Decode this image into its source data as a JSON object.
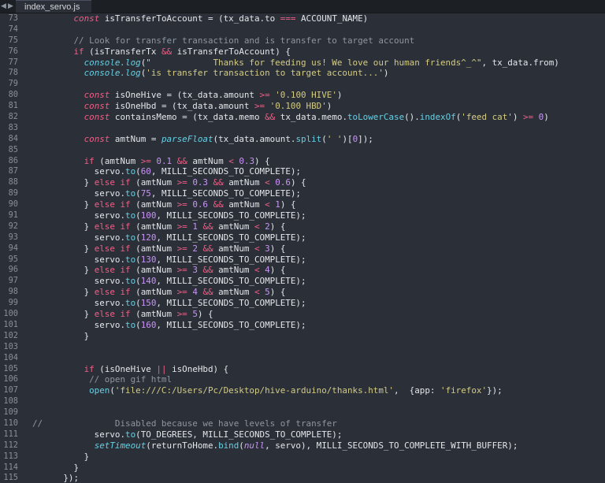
{
  "tab": {
    "filename": "index_servo.js",
    "nav_left": "◀",
    "nav_right": "▶"
  },
  "colors": {
    "background": "#2b3038",
    "keyword": "#ef5e86",
    "plain": "#e3e6ea",
    "string": "#d3cb84",
    "number": "#c994f6",
    "function": "#66cfe4",
    "comment": "#8e959e",
    "line_number": "#8a8f96"
  },
  "lines": [
    {
      "n": "73",
      "tokens": [
        [
          "        ",
          "pl"
        ],
        [
          "const",
          "kw"
        ],
        [
          " isTransferToAccount = (tx_data.to ",
          "pl"
        ],
        [
          "===",
          "op"
        ],
        [
          " ACCOUNT_NAME)",
          "pl"
        ]
      ]
    },
    {
      "n": "74",
      "tokens": []
    },
    {
      "n": "75",
      "tokens": [
        [
          "        ",
          "pl"
        ],
        [
          "// Look for transfer transaction and is transfer to target account",
          "cm"
        ]
      ]
    },
    {
      "n": "76",
      "tokens": [
        [
          "        ",
          "pl"
        ],
        [
          "if",
          "op"
        ],
        [
          " (isTransferTx ",
          "pl"
        ],
        [
          "&&",
          "op"
        ],
        [
          " isTransferToAccount) {",
          "pl"
        ]
      ]
    },
    {
      "n": "77",
      "tokens": [
        [
          "          ",
          "pl"
        ],
        [
          "console.log",
          "fn it"
        ],
        [
          "(",
          "pl"
        ],
        [
          "\"            Thanks for feeding us! We love our human friends^_^\"",
          "str"
        ],
        [
          ", tx_data.from)",
          "pl"
        ]
      ]
    },
    {
      "n": "78",
      "tokens": [
        [
          "          ",
          "pl"
        ],
        [
          "console.log",
          "fn it"
        ],
        [
          "(",
          "pl"
        ],
        [
          "'is transfer transaction to target account...'",
          "str"
        ],
        [
          ")",
          "pl"
        ]
      ]
    },
    {
      "n": "79",
      "tokens": []
    },
    {
      "n": "80",
      "tokens": [
        [
          "          ",
          "pl"
        ],
        [
          "const",
          "kw"
        ],
        [
          " isOneHive = (tx_data.amount ",
          "pl"
        ],
        [
          ">=",
          "op"
        ],
        [
          " ",
          "pl"
        ],
        [
          "'0.100 HIVE'",
          "str"
        ],
        [
          ")",
          "pl"
        ]
      ]
    },
    {
      "n": "81",
      "tokens": [
        [
          "          ",
          "pl"
        ],
        [
          "const",
          "kw"
        ],
        [
          " isOneHbd = (tx_data.amount ",
          "pl"
        ],
        [
          ">=",
          "op"
        ],
        [
          " ",
          "pl"
        ],
        [
          "'0.100 HBD'",
          "str"
        ],
        [
          ")",
          "pl"
        ]
      ]
    },
    {
      "n": "82",
      "tokens": [
        [
          "          ",
          "pl"
        ],
        [
          "const",
          "kw"
        ],
        [
          " containsMemo = (tx_data.memo ",
          "pl"
        ],
        [
          "&&",
          "op"
        ],
        [
          " tx_data.memo.",
          "pl"
        ],
        [
          "toLowerCase",
          "fn"
        ],
        [
          "().",
          "pl"
        ],
        [
          "indexOf",
          "fn"
        ],
        [
          "(",
          "pl"
        ],
        [
          "'feed cat'",
          "str"
        ],
        [
          ") ",
          "pl"
        ],
        [
          ">=",
          "op"
        ],
        [
          " ",
          "pl"
        ],
        [
          "0",
          "num"
        ],
        [
          ")",
          "pl"
        ]
      ]
    },
    {
      "n": "83",
      "tokens": []
    },
    {
      "n": "84",
      "tokens": [
        [
          "          ",
          "pl"
        ],
        [
          "const",
          "kw"
        ],
        [
          " amtNum = ",
          "pl"
        ],
        [
          "parseFloat",
          "fn it"
        ],
        [
          "(tx_data.amount.",
          "pl"
        ],
        [
          "split",
          "fn"
        ],
        [
          "(",
          "pl"
        ],
        [
          "' '",
          "str"
        ],
        [
          ")[",
          "pl"
        ],
        [
          "0",
          "num"
        ],
        [
          "]);",
          "pl"
        ]
      ]
    },
    {
      "n": "85",
      "tokens": []
    },
    {
      "n": "86",
      "tokens": [
        [
          "          ",
          "pl"
        ],
        [
          "if",
          "op"
        ],
        [
          " (amtNum ",
          "pl"
        ],
        [
          ">=",
          "op"
        ],
        [
          " ",
          "pl"
        ],
        [
          "0.1",
          "num"
        ],
        [
          " ",
          "pl"
        ],
        [
          "&&",
          "op"
        ],
        [
          " amtNum ",
          "pl"
        ],
        [
          "<",
          "op"
        ],
        [
          " ",
          "pl"
        ],
        [
          "0.3",
          "num"
        ],
        [
          ") {",
          "pl"
        ]
      ]
    },
    {
      "n": "87",
      "tokens": [
        [
          "            servo.",
          "pl"
        ],
        [
          "to",
          "fn"
        ],
        [
          "(",
          "pl"
        ],
        [
          "60",
          "num"
        ],
        [
          ", MILLI_SECONDS_TO_COMPLETE);",
          "pl"
        ]
      ]
    },
    {
      "n": "88",
      "tokens": [
        [
          "          } ",
          "pl"
        ],
        [
          "else",
          "op"
        ],
        [
          " ",
          "pl"
        ],
        [
          "if",
          "op"
        ],
        [
          " (amtNum ",
          "pl"
        ],
        [
          ">=",
          "op"
        ],
        [
          " ",
          "pl"
        ],
        [
          "0.3",
          "num"
        ],
        [
          " ",
          "pl"
        ],
        [
          "&&",
          "op"
        ],
        [
          " amtNum ",
          "pl"
        ],
        [
          "<",
          "op"
        ],
        [
          " ",
          "pl"
        ],
        [
          "0.6",
          "num"
        ],
        [
          ") {",
          "pl"
        ]
      ]
    },
    {
      "n": "89",
      "tokens": [
        [
          "            servo.",
          "pl"
        ],
        [
          "to",
          "fn"
        ],
        [
          "(",
          "pl"
        ],
        [
          "75",
          "num"
        ],
        [
          ", MILLI_SECONDS_TO_COMPLETE);",
          "pl"
        ]
      ]
    },
    {
      "n": "90",
      "tokens": [
        [
          "          } ",
          "pl"
        ],
        [
          "else",
          "op"
        ],
        [
          " ",
          "pl"
        ],
        [
          "if",
          "op"
        ],
        [
          " (amtNum ",
          "pl"
        ],
        [
          ">=",
          "op"
        ],
        [
          " ",
          "pl"
        ],
        [
          "0.6",
          "num"
        ],
        [
          " ",
          "pl"
        ],
        [
          "&&",
          "op"
        ],
        [
          " amtNum ",
          "pl"
        ],
        [
          "<",
          "op"
        ],
        [
          " ",
          "pl"
        ],
        [
          "1",
          "num"
        ],
        [
          ") {",
          "pl"
        ]
      ]
    },
    {
      "n": "91",
      "tokens": [
        [
          "            servo.",
          "pl"
        ],
        [
          "to",
          "fn"
        ],
        [
          "(",
          "pl"
        ],
        [
          "100",
          "num"
        ],
        [
          ", MILLI_SECONDS_TO_COMPLETE);",
          "pl"
        ]
      ]
    },
    {
      "n": "92",
      "tokens": [
        [
          "          } ",
          "pl"
        ],
        [
          "else",
          "op"
        ],
        [
          " ",
          "pl"
        ],
        [
          "if",
          "op"
        ],
        [
          " (amtNum ",
          "pl"
        ],
        [
          ">=",
          "op"
        ],
        [
          " ",
          "pl"
        ],
        [
          "1",
          "num"
        ],
        [
          " ",
          "pl"
        ],
        [
          "&&",
          "op"
        ],
        [
          " amtNum ",
          "pl"
        ],
        [
          "<",
          "op"
        ],
        [
          " ",
          "pl"
        ],
        [
          "2",
          "num"
        ],
        [
          ") {",
          "pl"
        ]
      ]
    },
    {
      "n": "93",
      "tokens": [
        [
          "            servo.",
          "pl"
        ],
        [
          "to",
          "fn"
        ],
        [
          "(",
          "pl"
        ],
        [
          "120",
          "num"
        ],
        [
          ", MILLI_SECONDS_TO_COMPLETE);",
          "pl"
        ]
      ]
    },
    {
      "n": "94",
      "tokens": [
        [
          "          } ",
          "pl"
        ],
        [
          "else",
          "op"
        ],
        [
          " ",
          "pl"
        ],
        [
          "if",
          "op"
        ],
        [
          " (amtNum ",
          "pl"
        ],
        [
          ">=",
          "op"
        ],
        [
          " ",
          "pl"
        ],
        [
          "2",
          "num"
        ],
        [
          " ",
          "pl"
        ],
        [
          "&&",
          "op"
        ],
        [
          " amtNum ",
          "pl"
        ],
        [
          "<",
          "op"
        ],
        [
          " ",
          "pl"
        ],
        [
          "3",
          "num"
        ],
        [
          ") {",
          "pl"
        ]
      ]
    },
    {
      "n": "95",
      "tokens": [
        [
          "            servo.",
          "pl"
        ],
        [
          "to",
          "fn"
        ],
        [
          "(",
          "pl"
        ],
        [
          "130",
          "num"
        ],
        [
          ", MILLI_SECONDS_TO_COMPLETE);",
          "pl"
        ]
      ]
    },
    {
      "n": "96",
      "tokens": [
        [
          "          } ",
          "pl"
        ],
        [
          "else",
          "op"
        ],
        [
          " ",
          "pl"
        ],
        [
          "if",
          "op"
        ],
        [
          " (amtNum ",
          "pl"
        ],
        [
          ">=",
          "op"
        ],
        [
          " ",
          "pl"
        ],
        [
          "3",
          "num"
        ],
        [
          " ",
          "pl"
        ],
        [
          "&&",
          "op"
        ],
        [
          " amtNum ",
          "pl"
        ],
        [
          "<",
          "op"
        ],
        [
          " ",
          "pl"
        ],
        [
          "4",
          "num"
        ],
        [
          ") {",
          "pl"
        ]
      ]
    },
    {
      "n": "97",
      "tokens": [
        [
          "            servo.",
          "pl"
        ],
        [
          "to",
          "fn"
        ],
        [
          "(",
          "pl"
        ],
        [
          "140",
          "num"
        ],
        [
          ", MILLI_SECONDS_TO_COMPLETE);",
          "pl"
        ]
      ]
    },
    {
      "n": "98",
      "tokens": [
        [
          "          } ",
          "pl"
        ],
        [
          "else",
          "op"
        ],
        [
          " ",
          "pl"
        ],
        [
          "if",
          "op"
        ],
        [
          " (amtNum ",
          "pl"
        ],
        [
          ">=",
          "op"
        ],
        [
          " ",
          "pl"
        ],
        [
          "4",
          "num"
        ],
        [
          " ",
          "pl"
        ],
        [
          "&&",
          "op"
        ],
        [
          " amtNum ",
          "pl"
        ],
        [
          "<",
          "op"
        ],
        [
          " ",
          "pl"
        ],
        [
          "5",
          "num"
        ],
        [
          ") {",
          "pl"
        ]
      ]
    },
    {
      "n": "99",
      "tokens": [
        [
          "            servo.",
          "pl"
        ],
        [
          "to",
          "fn"
        ],
        [
          "(",
          "pl"
        ],
        [
          "150",
          "num"
        ],
        [
          ", MILLI_SECONDS_TO_COMPLETE);",
          "pl"
        ]
      ]
    },
    {
      "n": "100",
      "tokens": [
        [
          "          } ",
          "pl"
        ],
        [
          "else",
          "op"
        ],
        [
          " ",
          "pl"
        ],
        [
          "if",
          "op"
        ],
        [
          " (amtNum ",
          "pl"
        ],
        [
          ">=",
          "op"
        ],
        [
          " ",
          "pl"
        ],
        [
          "5",
          "num"
        ],
        [
          ") {",
          "pl"
        ]
      ]
    },
    {
      "n": "101",
      "tokens": [
        [
          "            servo.",
          "pl"
        ],
        [
          "to",
          "fn"
        ],
        [
          "(",
          "pl"
        ],
        [
          "160",
          "num"
        ],
        [
          ", MILLI_SECONDS_TO_COMPLETE);",
          "pl"
        ]
      ]
    },
    {
      "n": "102",
      "tokens": [
        [
          "          }",
          "pl"
        ]
      ]
    },
    {
      "n": "103",
      "tokens": []
    },
    {
      "n": "104",
      "tokens": []
    },
    {
      "n": "105",
      "tokens": [
        [
          "          ",
          "pl"
        ],
        [
          "if",
          "op"
        ],
        [
          " (isOneHive ",
          "pl"
        ],
        [
          "||",
          "op"
        ],
        [
          " isOneHbd) {",
          "pl"
        ]
      ]
    },
    {
      "n": "106",
      "tokens": [
        [
          "           ",
          "pl"
        ],
        [
          "// open gif html",
          "cm"
        ]
      ]
    },
    {
      "n": "107",
      "tokens": [
        [
          "           ",
          "pl"
        ],
        [
          "open",
          "fn"
        ],
        [
          "(",
          "pl"
        ],
        [
          "'file:///C:/Users/Pc/Desktop/hive-arduino/thanks.html'",
          "str"
        ],
        [
          ",  {app: ",
          "pl"
        ],
        [
          "'firefox'",
          "str"
        ],
        [
          "});",
          "pl"
        ]
      ]
    },
    {
      "n": "108",
      "tokens": []
    },
    {
      "n": "109",
      "tokens": []
    },
    {
      "n": "110",
      "tokens": [
        [
          "//",
          "cm"
        ],
        [
          "              Disabled because we have levels of transfer",
          "cm"
        ]
      ]
    },
    {
      "n": "111",
      "tokens": [
        [
          "            servo.",
          "pl"
        ],
        [
          "to",
          "fn"
        ],
        [
          "(TO_DEGREES, MILLI_SECONDS_TO_COMPLETE);",
          "pl"
        ]
      ]
    },
    {
      "n": "112",
      "tokens": [
        [
          "            ",
          "pl"
        ],
        [
          "setTimeout",
          "fn it"
        ],
        [
          "(returnToHome.",
          "pl"
        ],
        [
          "bind",
          "fn"
        ],
        [
          "(",
          "pl"
        ],
        [
          "null",
          "num it"
        ],
        [
          ", servo), MILLI_SECONDS_TO_COMPLETE_WITH_BUFFER);",
          "pl"
        ]
      ]
    },
    {
      "n": "113",
      "tokens": [
        [
          "          }",
          "pl"
        ]
      ]
    },
    {
      "n": "114",
      "tokens": [
        [
          "        }",
          "pl"
        ]
      ]
    },
    {
      "n": "115",
      "tokens": [
        [
          "      });",
          "pl"
        ]
      ]
    }
  ]
}
